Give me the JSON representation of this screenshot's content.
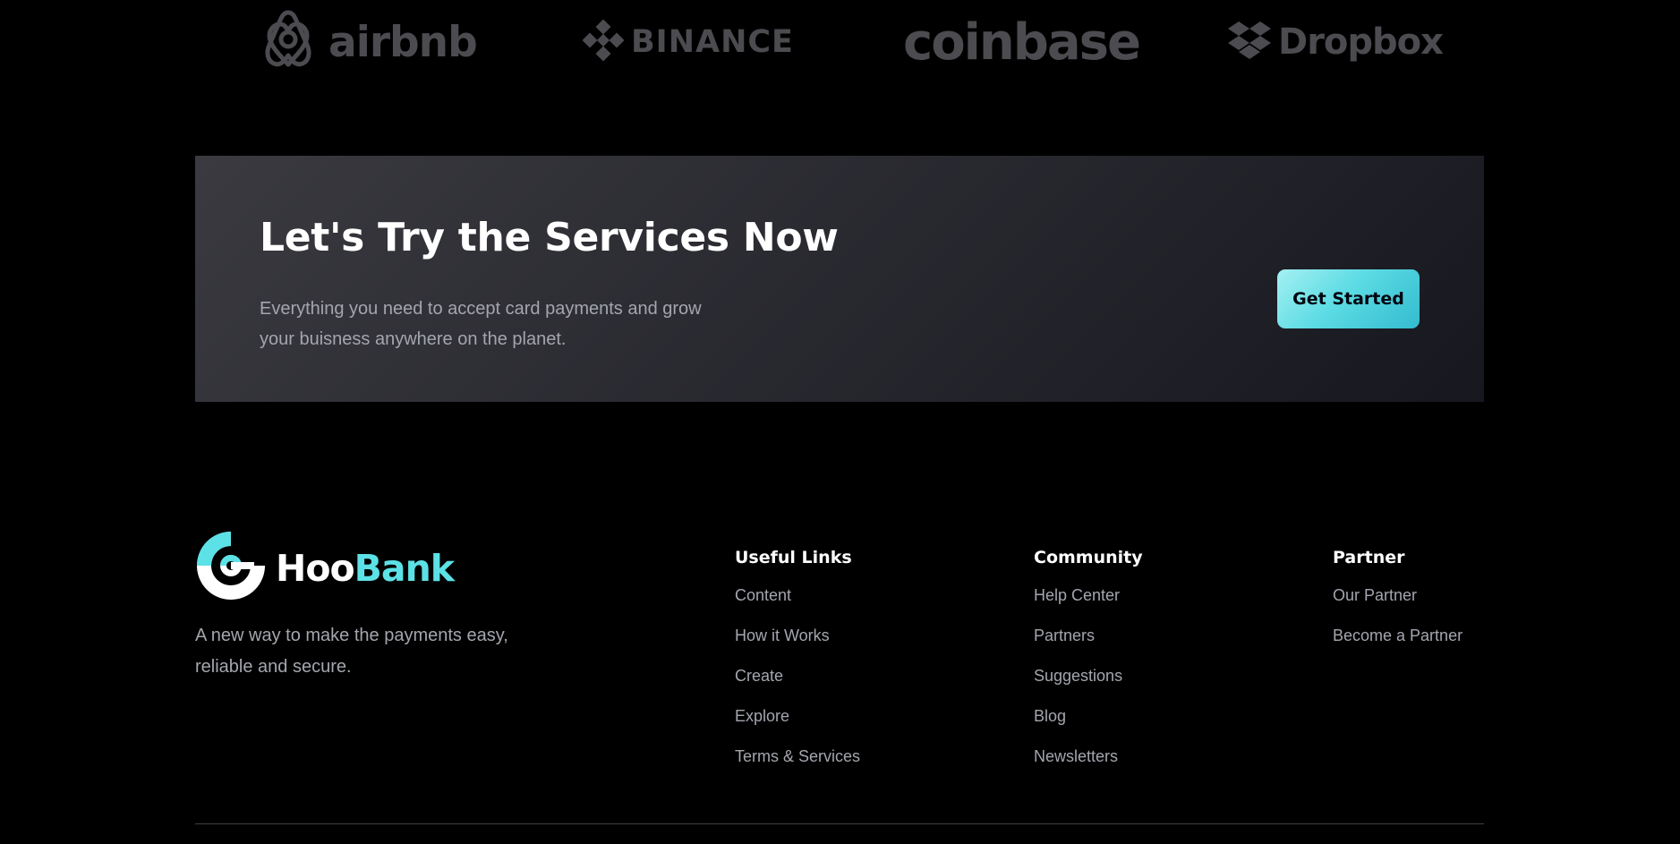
{
  "clients": [
    {
      "name": "airbnb",
      "icon": "airbnb-logo-icon"
    },
    {
      "name": "BINANCE",
      "icon": "binance-logo-icon"
    },
    {
      "name": "coinbase",
      "icon": "coinbase-logo-icon"
    },
    {
      "name": "Dropbox",
      "icon": "dropbox-logo-icon"
    }
  ],
  "cta": {
    "title": "Let's Try the Services Now",
    "description": "Everything you need to accept card payments and grow your buisness anywhere on the planet.",
    "button_label": "Get Started"
  },
  "footer": {
    "brand": {
      "name_part1": "Hoo",
      "name_part2": "Bank",
      "icon": "hoobank-logo-icon",
      "tagline": "A new way to make the payments easy, reliable and secure."
    },
    "columns": [
      {
        "title": "Useful Links",
        "links": [
          "Content",
          "How it Works",
          "Create",
          "Explore",
          "Terms & Services"
        ]
      },
      {
        "title": "Community",
        "links": [
          "Help Center",
          "Partners",
          "Suggestions",
          "Blog",
          "Newsletters"
        ]
      },
      {
        "title": "Partner",
        "links": [
          "Our Partner",
          "Become a Partner"
        ]
      }
    ]
  },
  "colors": {
    "background": "#000000",
    "accent": "#5ce1e6",
    "muted_text": "#a4a6ae",
    "logo_gray": "#4b4b50",
    "cta_gradient_start": "#3a3a40",
    "cta_gradient_end": "#17171f",
    "divider": "#3f3e45"
  }
}
